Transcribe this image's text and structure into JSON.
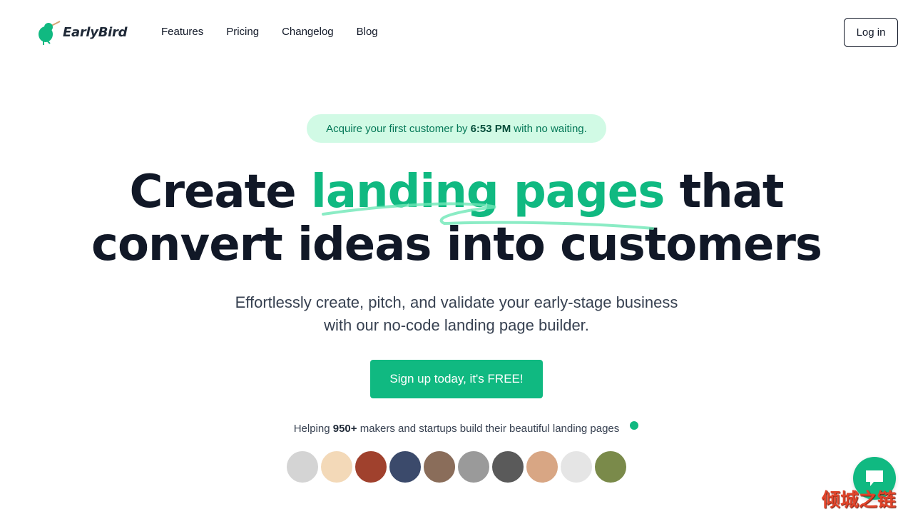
{
  "nav": {
    "logo_text": "EarlyBird",
    "links": [
      "Features",
      "Pricing",
      "Changelog",
      "Blog"
    ],
    "login_label": "Log in"
  },
  "hero": {
    "badge_prefix": "Acquire your first customer by",
    "badge_time": "6:53 PM",
    "badge_suffix": "with no waiting.",
    "headline_part1": "Create",
    "headline_accent": "landing pages",
    "headline_part2": "that",
    "headline_line2": "convert ideas into customers",
    "subtitle_line1": "Effortlessly create, pitch, and validate your early-stage business",
    "subtitle_line2": "with our no-code landing page builder.",
    "cta_label": "Sign up today, it's FREE!"
  },
  "social_proof": {
    "prefix": "Helping",
    "count": "950+",
    "suffix": "makers and startups build their beautiful landing pages",
    "avatars": [
      {
        "color": "#d4d4d4"
      },
      {
        "color": "#f3d9b8"
      },
      {
        "color": "#a0412d"
      },
      {
        "color": "#3b4a6b"
      },
      {
        "color": "#8a6d5a"
      },
      {
        "color": "#9a9a9a"
      },
      {
        "color": "#5a5a5a"
      },
      {
        "color": "#d8a684"
      },
      {
        "color": "#e5e5e5"
      },
      {
        "color": "#7a8a4a"
      }
    ]
  },
  "watermark": "倾城之链",
  "colors": {
    "accent": "#10b981",
    "badge_bg": "#d1fae5",
    "text_dark": "#111827"
  }
}
